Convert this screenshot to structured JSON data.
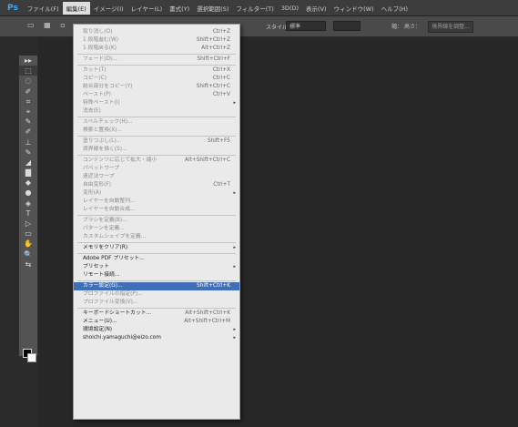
{
  "app": {
    "logo": "Ps"
  },
  "menubar": {
    "items": [
      {
        "label": "ファイル(F)"
      },
      {
        "label": "編集(E)"
      },
      {
        "label": "イメージ(I)"
      },
      {
        "label": "レイヤー(L)"
      },
      {
        "label": "書式(Y)"
      },
      {
        "label": "選択範囲(S)"
      },
      {
        "label": "フィルター(T)"
      },
      {
        "label": "3D(D)"
      },
      {
        "label": "表示(V)"
      },
      {
        "label": "ウィンドウ(W)"
      },
      {
        "label": "ヘルプ(H)"
      }
    ],
    "active_index": 1
  },
  "options": {
    "icons": "▭ ▦ ▫ ▫",
    "style_label": "スタイル：",
    "style_value": "標準",
    "w_label": "幅：",
    "h_label": "高さ：",
    "refine_label": "境界線を調整..."
  },
  "toolbar": {
    "tools": [
      "▸▸",
      "⬚",
      "◌",
      "✐",
      "⌗",
      "⌖",
      "✎",
      "✐",
      "⊥",
      "✎",
      "◢",
      "▇",
      "◆",
      "●",
      "◈",
      "T",
      "▷",
      "▭",
      "✋",
      "🔍",
      "⇆"
    ],
    "selected_index": 1
  },
  "edit_menu": {
    "items": [
      {
        "label": "取り消し(O)",
        "shortcut": "Ctrl+Z",
        "disabled": true
      },
      {
        "label": "1 段階進む(W)",
        "shortcut": "Shift+Ctrl+Z",
        "disabled": true
      },
      {
        "label": "1 段階戻る(K)",
        "shortcut": "Alt+Ctrl+Z",
        "disabled": true
      },
      {
        "sep": true
      },
      {
        "label": "フェード(D)...",
        "shortcut": "Shift+Ctrl+F",
        "disabled": true
      },
      {
        "sep": true
      },
      {
        "label": "カット(T)",
        "shortcut": "Ctrl+X",
        "disabled": true
      },
      {
        "label": "コピー(C)",
        "shortcut": "Ctrl+C",
        "disabled": true
      },
      {
        "label": "結合部分をコピー(Y)",
        "shortcut": "Shift+Ctrl+C",
        "disabled": true
      },
      {
        "label": "ペースト(P)",
        "shortcut": "Ctrl+V",
        "disabled": true
      },
      {
        "label": "特殊ペースト(I)",
        "submenu": true,
        "disabled": true
      },
      {
        "label": "消去(E)",
        "disabled": true
      },
      {
        "sep": true
      },
      {
        "label": "スペルチェック(H)...",
        "disabled": true
      },
      {
        "label": "検索と置換(X)...",
        "disabled": true
      },
      {
        "sep": true
      },
      {
        "label": "塗りつぶし(L)...",
        "shortcut": "Shift+F5",
        "disabled": true
      },
      {
        "label": "境界線を描く(S)...",
        "disabled": true
      },
      {
        "sep": true
      },
      {
        "label": "コンテンツに応じて拡大・縮小",
        "shortcut": "Alt+Shift+Ctrl+C",
        "disabled": true
      },
      {
        "label": "パペットワープ",
        "disabled": true
      },
      {
        "label": "遠近法ワープ",
        "disabled": true
      },
      {
        "label": "自由変形(F)",
        "shortcut": "Ctrl+T",
        "disabled": true
      },
      {
        "label": "変形(A)",
        "submenu": true,
        "disabled": true
      },
      {
        "label": "レイヤーを自動整列...",
        "disabled": true
      },
      {
        "label": "レイヤーを自動合成...",
        "disabled": true
      },
      {
        "sep": true
      },
      {
        "label": "ブラシを定義(B)...",
        "disabled": true
      },
      {
        "label": "パターンを定義...",
        "disabled": true
      },
      {
        "label": "カスタムシェイプを定義...",
        "disabled": true
      },
      {
        "sep": true
      },
      {
        "label": "メモリをクリア(R)",
        "submenu": true,
        "disabled": false
      },
      {
        "sep": true
      },
      {
        "label": "Adobe PDF プリセット...",
        "disabled": false
      },
      {
        "label": "プリセット",
        "submenu": true,
        "disabled": false
      },
      {
        "label": "リモート接続...",
        "disabled": false
      },
      {
        "sep": true
      },
      {
        "label": "カラー設定(G)...",
        "shortcut": "Shift+Ctrl+K",
        "highlighted": true
      },
      {
        "label": "プロファイルの指定(P)...",
        "disabled": true
      },
      {
        "label": "プロファイル変換(V)...",
        "disabled": true
      },
      {
        "sep": true
      },
      {
        "label": "キーボードショートカット...",
        "shortcut": "Alt+Shift+Ctrl+K",
        "disabled": false
      },
      {
        "label": "メニュー(U)...",
        "shortcut": "Alt+Shift+Ctrl+M",
        "disabled": false
      },
      {
        "label": "環境設定(N)",
        "submenu": true,
        "disabled": false
      },
      {
        "label": "shoichi.yamaguchi@eizo.com",
        "submenu": true,
        "disabled": false
      }
    ]
  }
}
